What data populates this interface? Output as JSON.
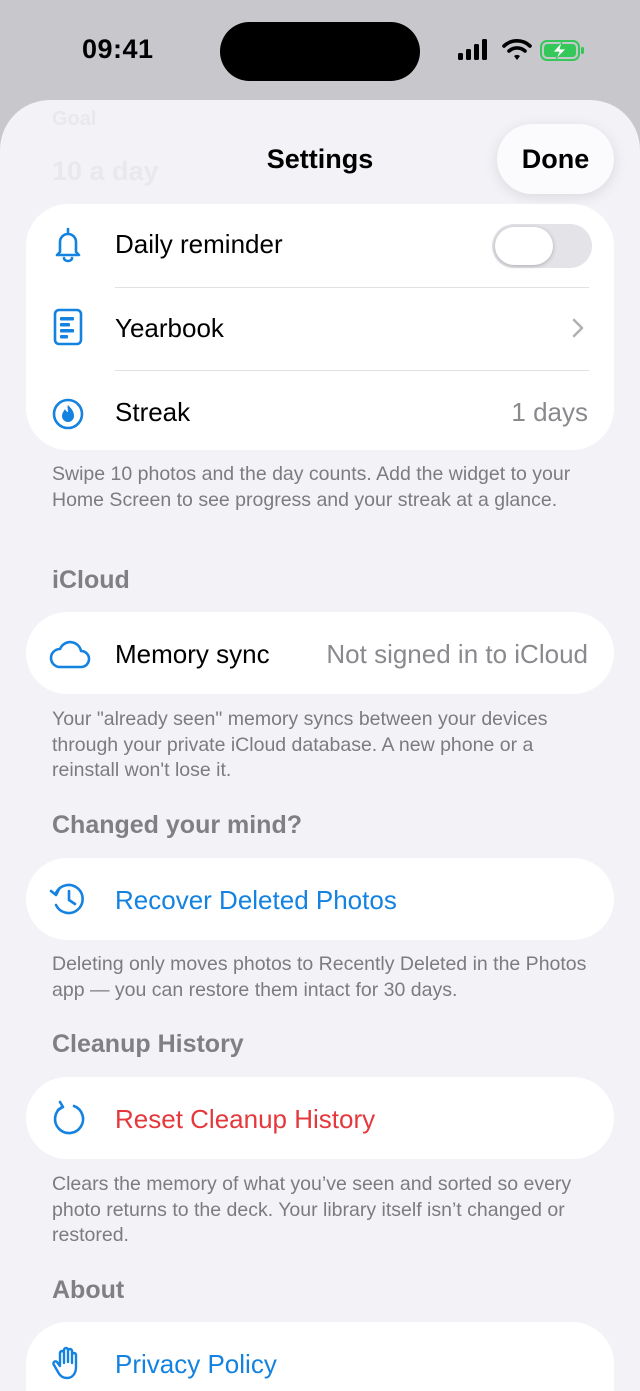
{
  "status_bar": {
    "time": "09:41"
  },
  "nav": {
    "title": "Settings",
    "done_label": "Done"
  },
  "background": {
    "line1": "Goal",
    "line2": "10 a day"
  },
  "streak_section": {
    "rows": [
      {
        "icon": "bell-icon",
        "label": "Daily reminder",
        "toggle_on": false
      },
      {
        "icon": "yearbook-icon",
        "label": "Yearbook"
      },
      {
        "icon": "flame-icon",
        "label": "Streak",
        "value": "1 days"
      }
    ],
    "footer": "Swipe 10 photos and the day counts. Add the widget to your Home Screen to see progress and your streak at a glance."
  },
  "icloud_section": {
    "header": "iCloud",
    "row": {
      "icon": "cloud-icon",
      "label": "Memory sync",
      "value": "Not signed in to iCloud"
    },
    "footer": "Your \"already seen\" memory syncs between your devices through your private iCloud database. A new phone or a reinstall won't lose it."
  },
  "recover_section": {
    "header": "Changed your mind?",
    "row": {
      "icon": "history-icon",
      "label": "Recover Deleted Photos"
    },
    "footer": "Deleting only moves photos to Recently Deleted in the Photos app — you can restore them intact for 30 days."
  },
  "cleanup_section": {
    "header": "Cleanup History",
    "row": {
      "icon": "reset-icon",
      "label": "Reset Cleanup History"
    },
    "footer": "Clears the memory of what you’ve seen and sorted so every photo returns to the deck. Your library itself isn’t changed or restored."
  },
  "about_section": {
    "header": "About",
    "row": {
      "icon": "hand-icon",
      "label": "Privacy Policy"
    }
  },
  "colors": {
    "accent": "#1482e0",
    "destructive": "#e5383d",
    "battery": "#34c759"
  }
}
